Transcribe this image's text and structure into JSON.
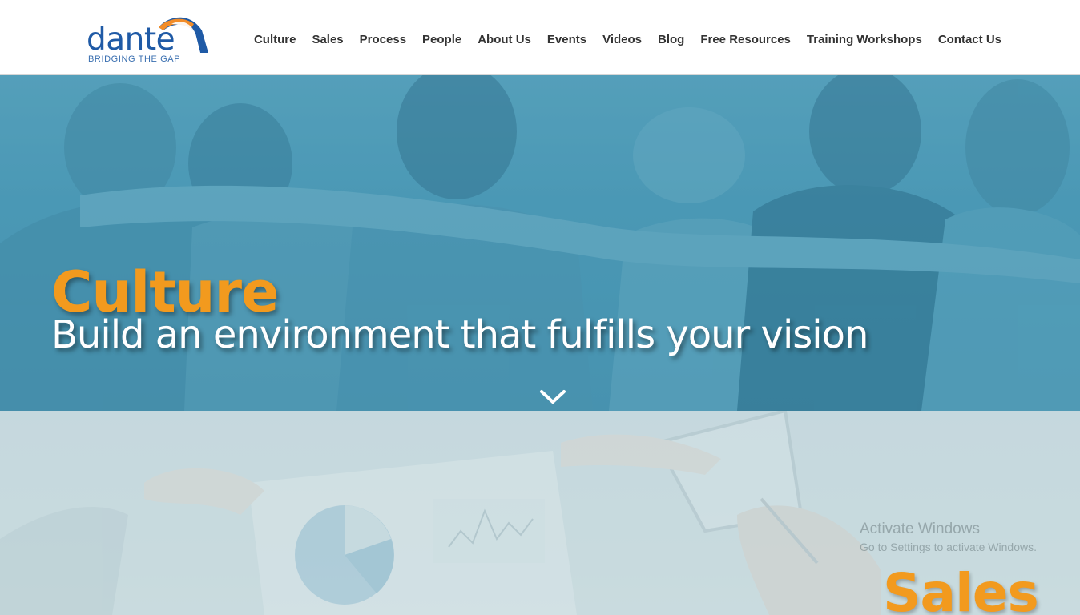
{
  "brand": {
    "name": "dante",
    "tagline": "BRIDGING THE GAP",
    "colors": {
      "blue": "#1f5aa6",
      "orange": "#f28c28"
    }
  },
  "nav": {
    "items": [
      {
        "label": "Culture"
      },
      {
        "label": "Sales"
      },
      {
        "label": "Process"
      },
      {
        "label": "People"
      },
      {
        "label": "About Us"
      },
      {
        "label": "Events"
      },
      {
        "label": "Videos"
      },
      {
        "label": "Blog"
      },
      {
        "label": "Free Resources"
      },
      {
        "label": "Training Workshops"
      },
      {
        "label": "Contact Us"
      }
    ]
  },
  "hero": {
    "title": "Culture",
    "subtitle": "Build an environment that fulfills your vision",
    "scroll_icon": "chevron-down-icon",
    "colors": {
      "overlay": "#4a98b5",
      "title": "#f29a1e",
      "subtitle": "#ffffff"
    }
  },
  "sales": {
    "title": "Sales",
    "colors": {
      "overlay": "#c6d9de",
      "title": "#f29a1e"
    }
  },
  "watermark": {
    "title": "Activate Windows",
    "subtitle": "Go to Settings to activate Windows."
  }
}
